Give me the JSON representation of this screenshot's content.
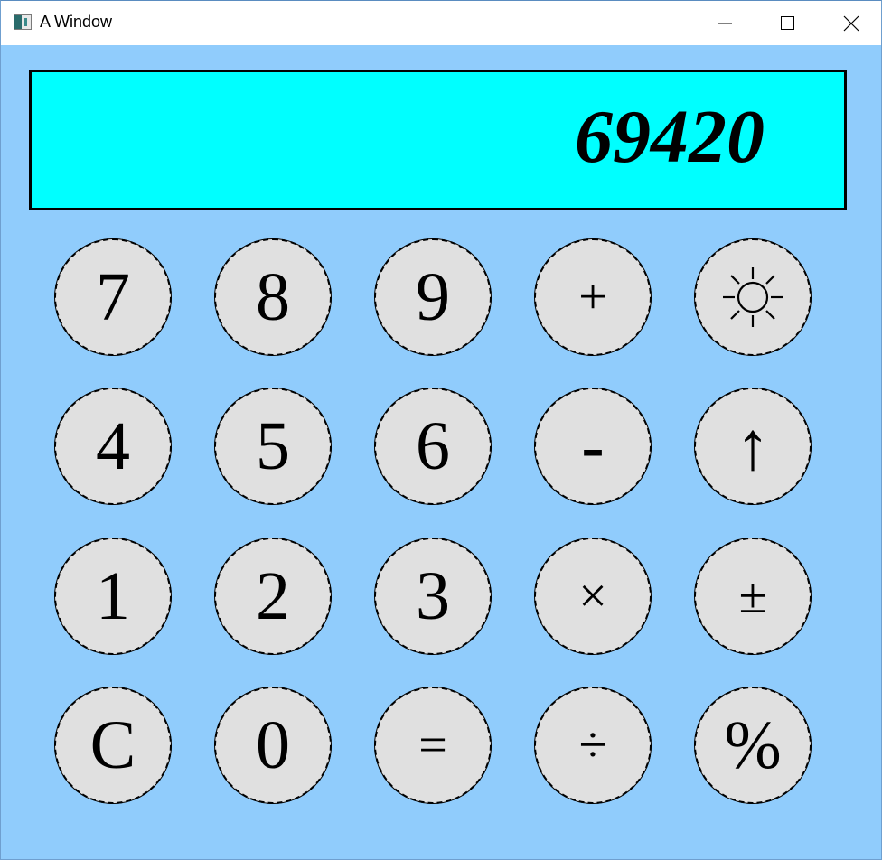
{
  "window": {
    "title": "A Window",
    "icon": "app-window-icon",
    "controls": [
      "minimize-icon",
      "maximize-icon",
      "close-icon"
    ]
  },
  "display": {
    "value": "69420",
    "background": "#00ffff"
  },
  "colors": {
    "client_background": "#90ccfc",
    "key_background": "#e0e0e0",
    "key_border": "#000000",
    "display_background": "#00ffff"
  },
  "keys": {
    "k7": "7",
    "k8": "8",
    "k9": "9",
    "plus": "+",
    "brightness": "sun-icon",
    "k4": "4",
    "k5": "5",
    "k6": "6",
    "minus": "-",
    "up": "↑",
    "k1": "1",
    "k2": "2",
    "k3": "3",
    "multiply": "×",
    "plusminus": "±",
    "clear": "C",
    "k0": "0",
    "equals": "=",
    "divide": "÷",
    "percent": "%"
  }
}
